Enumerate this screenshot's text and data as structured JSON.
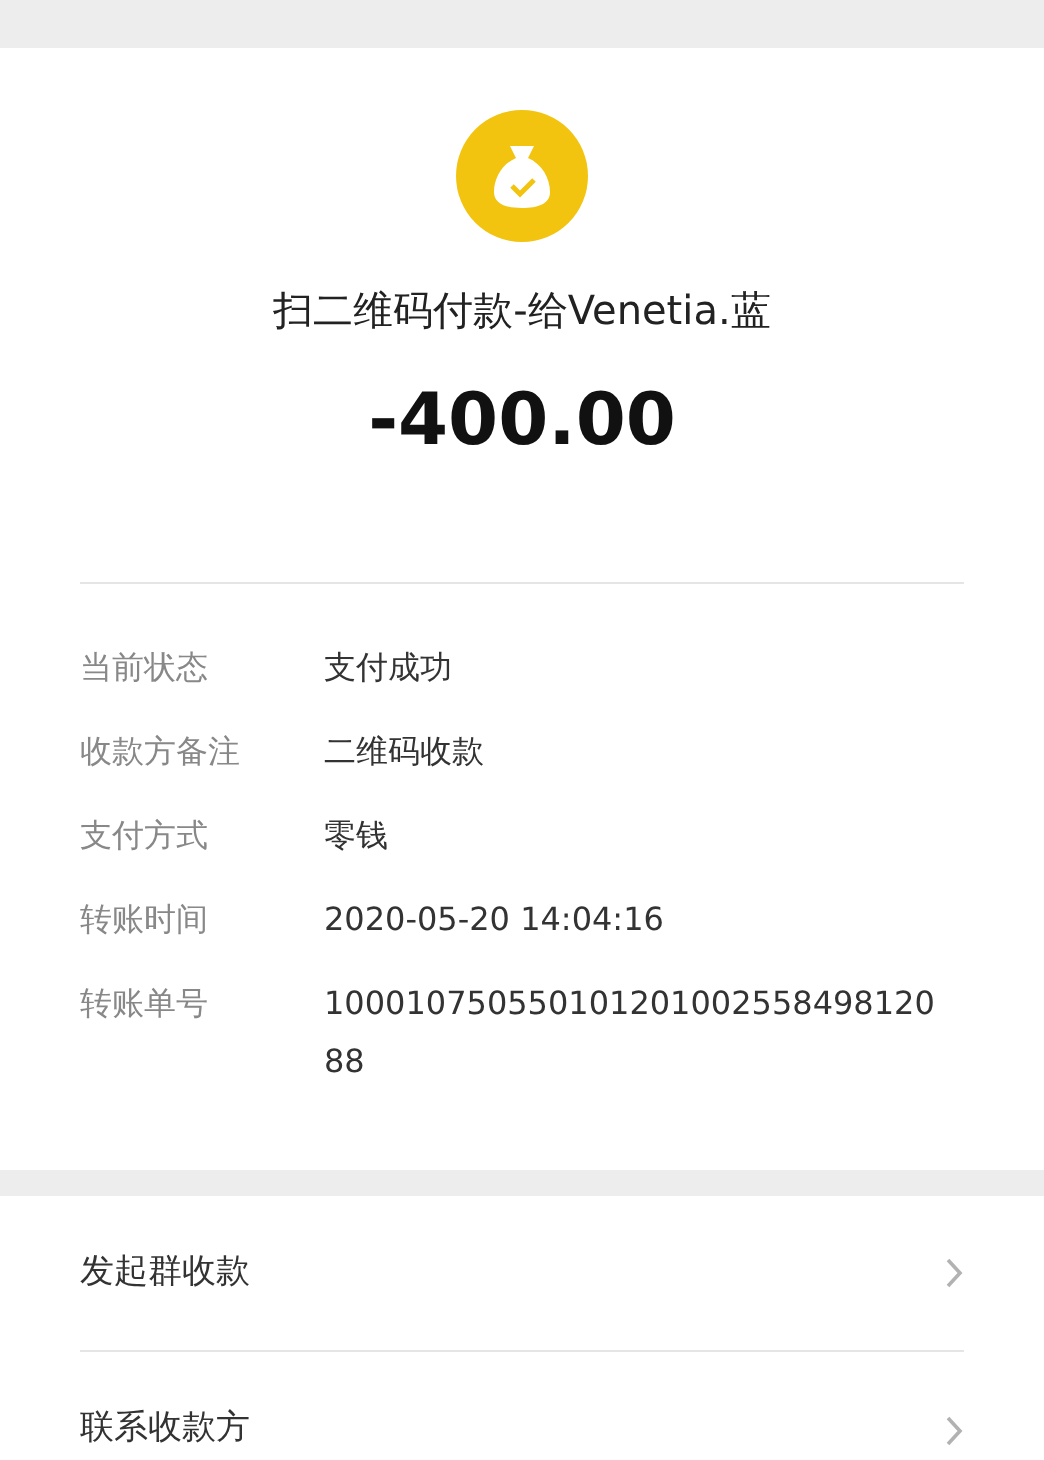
{
  "title": "扫二维码付款-给Venetia.蓝",
  "amount": "-400.00",
  "details": [
    {
      "label": "当前状态",
      "value": "支付成功"
    },
    {
      "label": "收款方备注",
      "value": "二维码收款"
    },
    {
      "label": "支付方式",
      "value": "零钱"
    },
    {
      "label": "转账时间",
      "value": "2020-05-20 14:04:16"
    },
    {
      "label": "转账单号",
      "value": "100010750550101201002558498120 88"
    }
  ],
  "actions": [
    {
      "label": "发起群收款"
    },
    {
      "label": "联系收款方"
    }
  ]
}
